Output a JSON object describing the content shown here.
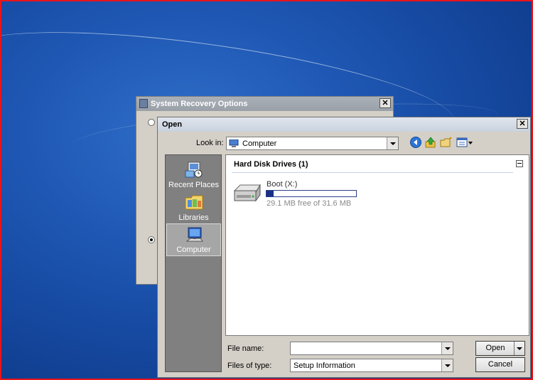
{
  "recovery_window": {
    "title": "System Recovery Options",
    "close_glyph": "✕"
  },
  "open_dialog": {
    "title": "Open",
    "close_glyph": "✕",
    "look_in_label": "Look in:",
    "look_in_value": "Computer",
    "places": [
      {
        "label": "Recent Places",
        "icon": "recent-places-icon"
      },
      {
        "label": "Libraries",
        "icon": "libraries-icon"
      },
      {
        "label": "Computer",
        "icon": "computer-icon",
        "selected": true
      }
    ],
    "group_header": "Hard Disk Drives (1)",
    "drive": {
      "name": "Boot (X:)",
      "free_text": "29.1 MB free of 31.6 MB",
      "used_fraction": 0.08
    },
    "file_name_label": "File name:",
    "file_name_value": "",
    "files_of_type_label": "Files of type:",
    "files_of_type_value": "Setup Information",
    "open_button": "Open",
    "cancel_button": "Cancel"
  }
}
